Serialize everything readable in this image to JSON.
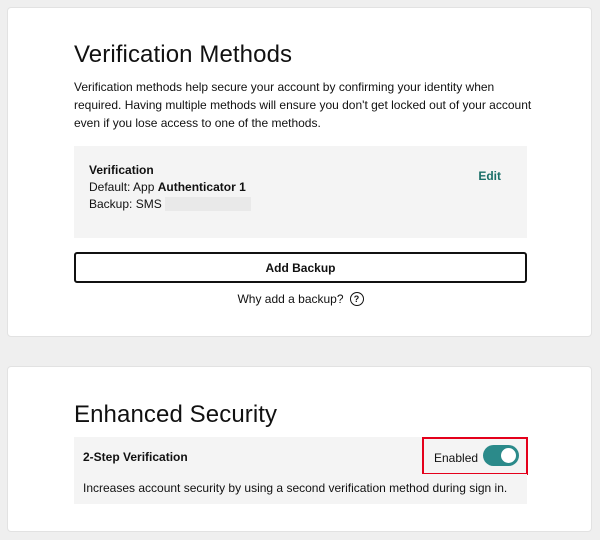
{
  "verification_methods": {
    "title": "Verification Methods",
    "description": "Verification methods help secure your account by confirming your identity when required. Having multiple methods will ensure you don't get locked out of your account even if you lose access to one of the methods.",
    "box": {
      "title": "Verification",
      "default_prefix": "Default: App",
      "default_value": "Authenticator 1",
      "backup_prefix": "Backup: SMS",
      "edit_label": "Edit"
    },
    "add_backup_label": "Add Backup",
    "why_backup_label": "Why add a backup?",
    "help_icon": "?"
  },
  "enhanced_security": {
    "title": "Enhanced Security",
    "two_step_label": "2-Step Verification",
    "status_label": "Enabled",
    "toggle_on": true,
    "description": "Increases account security by using a second verification method during sign in."
  },
  "colors": {
    "accent": "#2b8a8a",
    "link": "#1b6f69",
    "highlight": "#e4001b"
  }
}
